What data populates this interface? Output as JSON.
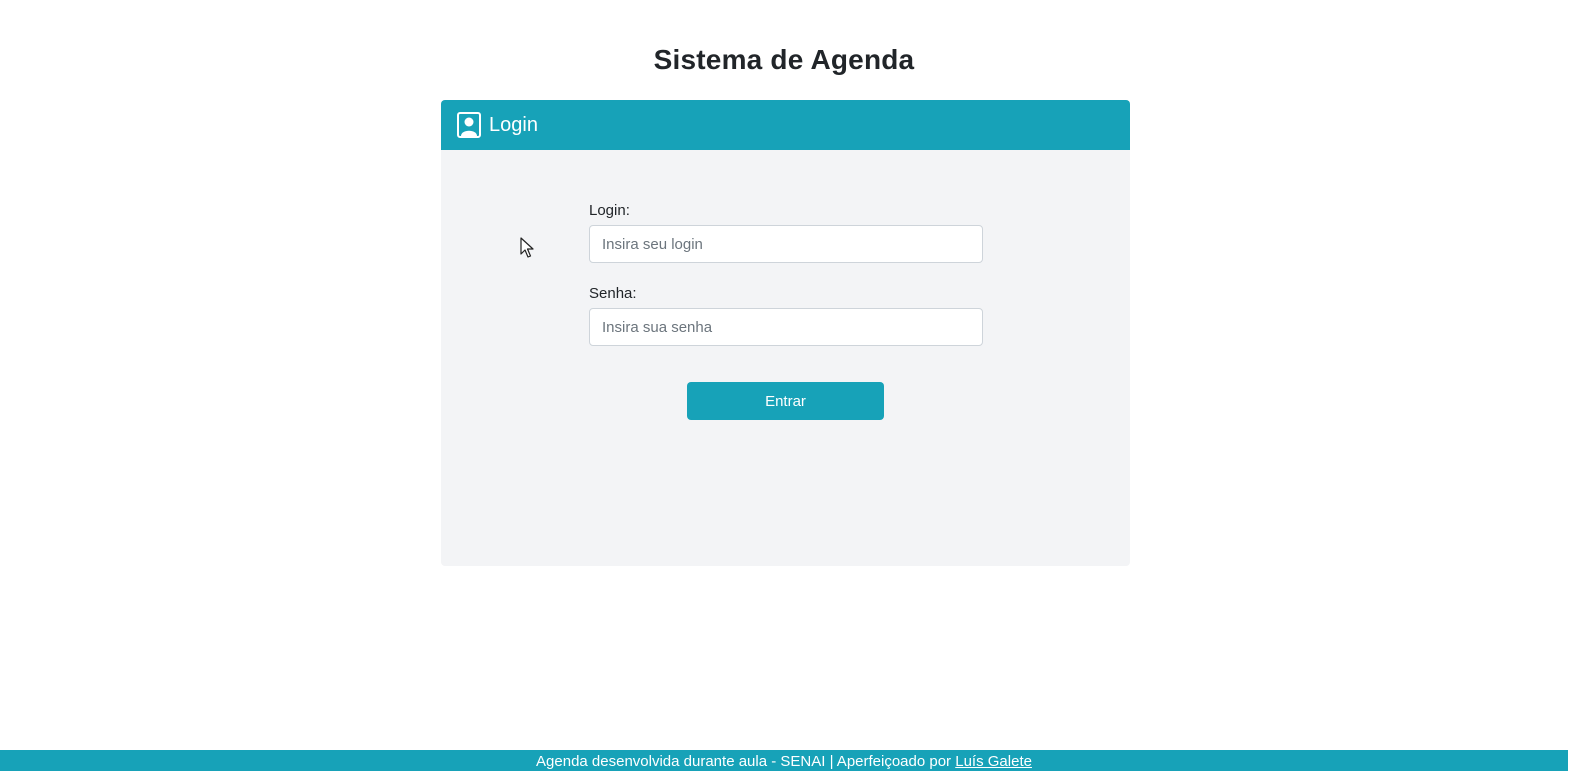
{
  "header": {
    "title": "Sistema de Agenda"
  },
  "card": {
    "icon": "user-icon",
    "title": "Login"
  },
  "form": {
    "login_label": "Login:",
    "login_placeholder": "Insira seu login",
    "login_value": "",
    "password_label": "Senha:",
    "password_placeholder": "Insira sua senha",
    "password_value": "",
    "submit_label": "Entrar"
  },
  "footer": {
    "text": "Agenda desenvolvida durante aula - SENAI | Aperfeiçoado por ",
    "link_text": "Luís Galete"
  },
  "colors": {
    "accent": "#17a2b8",
    "card_bg": "#f3f4f6"
  }
}
